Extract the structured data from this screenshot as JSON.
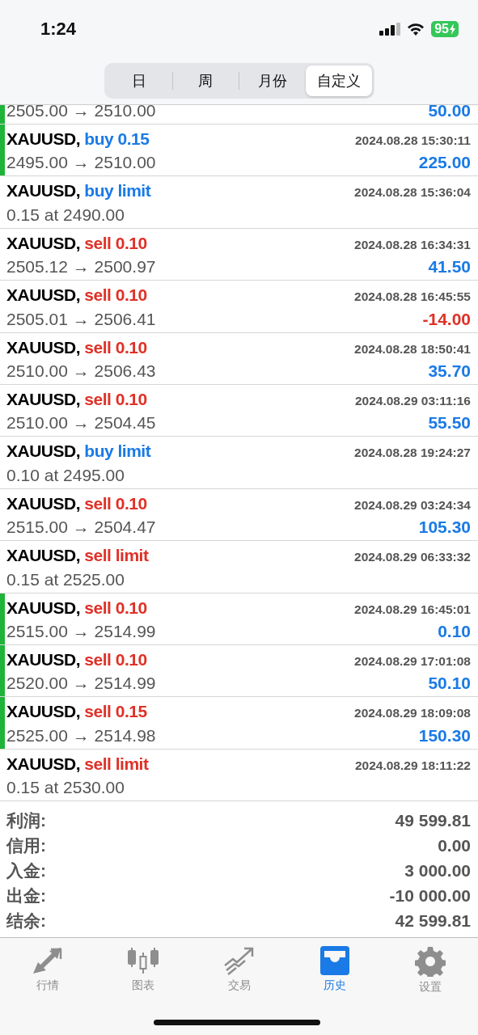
{
  "status_bar": {
    "time": "1:24",
    "battery": "95"
  },
  "tabs": [
    {
      "label": "日",
      "selected": false
    },
    {
      "label": "周",
      "selected": false
    },
    {
      "label": "月份",
      "selected": false
    },
    {
      "label": "自定义",
      "selected": true
    }
  ],
  "partial_row": {
    "detail": "2505.00 → 2510.00",
    "profit": "50.00",
    "loss": false,
    "highlighted": true
  },
  "rows": [
    {
      "symbol": "XAUUSD,",
      "kind": "buy",
      "action": "buy 0.15",
      "time": "2024.08.28 15:30:11",
      "detail": "2495.00 → 2510.00",
      "profit": "225.00",
      "loss": false,
      "highlighted": true
    },
    {
      "symbol": "XAUUSD,",
      "kind": "buy",
      "action": "buy limit",
      "time": "2024.08.28 15:36:04",
      "detail": "0.15 at 2490.00",
      "highlighted": false
    },
    {
      "symbol": "XAUUSD,",
      "kind": "sell",
      "action": "sell 0.10",
      "time": "2024.08.28 16:34:31",
      "detail": "2505.12 → 2500.97",
      "profit": "41.50",
      "loss": false,
      "highlighted": false
    },
    {
      "symbol": "XAUUSD,",
      "kind": "sell",
      "action": "sell 0.10",
      "time": "2024.08.28 16:45:55",
      "detail": "2505.01 → 2506.41",
      "profit": "-14.00",
      "loss": true,
      "highlighted": false
    },
    {
      "symbol": "XAUUSD,",
      "kind": "sell",
      "action": "sell 0.10",
      "time": "2024.08.28 18:50:41",
      "detail": "2510.00 → 2506.43",
      "profit": "35.70",
      "loss": false,
      "highlighted": false
    },
    {
      "symbol": "XAUUSD,",
      "kind": "sell",
      "action": "sell 0.10",
      "time": "2024.08.29 03:11:16",
      "detail": "2510.00 → 2504.45",
      "profit": "55.50",
      "loss": false,
      "highlighted": false
    },
    {
      "symbol": "XAUUSD,",
      "kind": "buy",
      "action": "buy limit",
      "time": "2024.08.28 19:24:27",
      "detail": "0.10 at 2495.00",
      "highlighted": false
    },
    {
      "symbol": "XAUUSD,",
      "kind": "sell",
      "action": "sell 0.10",
      "time": "2024.08.29 03:24:34",
      "detail": "2515.00 → 2504.47",
      "profit": "105.30",
      "loss": false,
      "highlighted": false
    },
    {
      "symbol": "XAUUSD,",
      "kind": "sell",
      "action": "sell limit",
      "time": "2024.08.29 06:33:32",
      "detail": "0.15 at 2525.00",
      "highlighted": false
    },
    {
      "symbol": "XAUUSD,",
      "kind": "sell",
      "action": "sell 0.10",
      "time": "2024.08.29 16:45:01",
      "detail": "2515.00 → 2514.99",
      "profit": "0.10",
      "loss": false,
      "highlighted": true
    },
    {
      "symbol": "XAUUSD,",
      "kind": "sell",
      "action": "sell 0.10",
      "time": "2024.08.29 17:01:08",
      "detail": "2520.00 → 2514.99",
      "profit": "50.10",
      "loss": false,
      "highlighted": true
    },
    {
      "symbol": "XAUUSD,",
      "kind": "sell",
      "action": "sell 0.15",
      "time": "2024.08.29 18:09:08",
      "detail": "2525.00 → 2514.98",
      "profit": "150.30",
      "loss": false,
      "highlighted": true
    },
    {
      "symbol": "XAUUSD,",
      "kind": "sell",
      "action": "sell limit",
      "time": "2024.08.29 18:11:22",
      "detail": "0.15 at 2530.00",
      "highlighted": false
    }
  ],
  "summary": [
    {
      "label": "利润:",
      "value": "49 599.81"
    },
    {
      "label": "信用:",
      "value": "0.00"
    },
    {
      "label": "入金:",
      "value": "3 000.00"
    },
    {
      "label": "出金:",
      "value": "-10 000.00"
    },
    {
      "label": "结余:",
      "value": "42 599.81"
    }
  ],
  "nav": [
    {
      "kind": "quotes",
      "label": "行情",
      "selected": false
    },
    {
      "kind": "chart",
      "label": "图表",
      "selected": false
    },
    {
      "kind": "trade",
      "label": "交易",
      "selected": false
    },
    {
      "kind": "history",
      "label": "历史",
      "selected": true
    },
    {
      "kind": "settings",
      "label": "设置",
      "selected": false
    }
  ]
}
